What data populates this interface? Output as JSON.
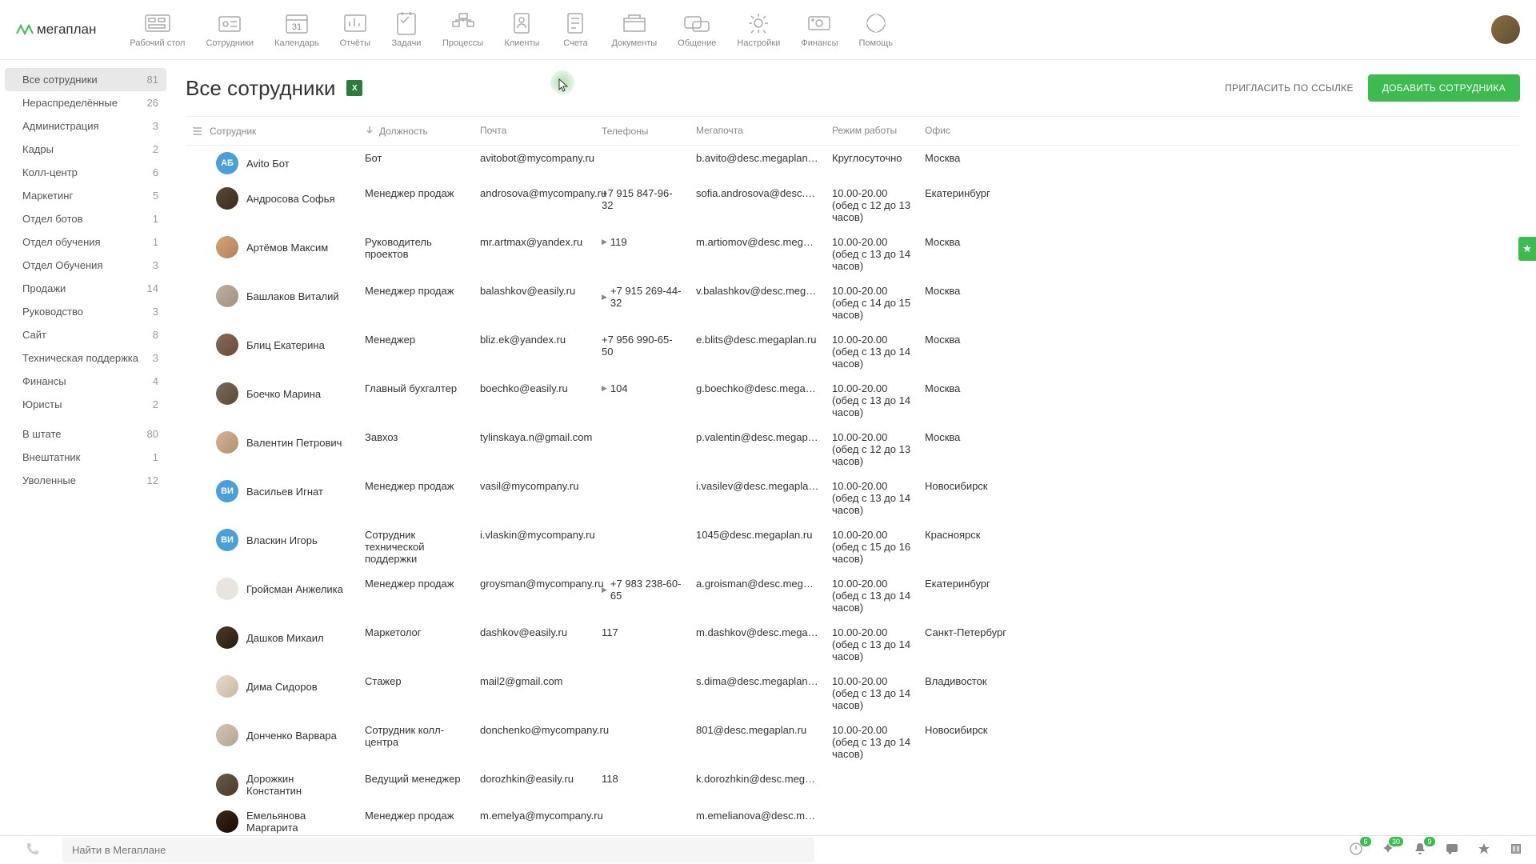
{
  "app": {
    "name": "мегаплан"
  },
  "nav": [
    {
      "label": "Рабочий стол"
    },
    {
      "label": "Сотрудники"
    },
    {
      "label": "Календарь"
    },
    {
      "label": "Отчёты"
    },
    {
      "label": "Задачи"
    },
    {
      "label": "Процессы"
    },
    {
      "label": "Клиенты"
    },
    {
      "label": "Счета"
    },
    {
      "label": "Документы"
    },
    {
      "label": "Общение"
    },
    {
      "label": "Настройки"
    },
    {
      "label": "Финансы"
    },
    {
      "label": "Помощь"
    }
  ],
  "sidebar": {
    "groups": [
      [
        {
          "label": "Все сотрудники",
          "count": "81",
          "active": true
        },
        {
          "label": "Нераспределённые",
          "count": "26"
        },
        {
          "label": "Администрация",
          "count": "3"
        },
        {
          "label": "Кадры",
          "count": "2"
        },
        {
          "label": "Колл-центр",
          "count": "6"
        },
        {
          "label": "Маркетинг",
          "count": "5"
        },
        {
          "label": "Отдел ботов",
          "count": "1"
        },
        {
          "label": "Отдел обучения",
          "count": "1"
        },
        {
          "label": "Отдел Обучения",
          "count": "3"
        },
        {
          "label": "Продажи",
          "count": "14"
        },
        {
          "label": "Руководство",
          "count": "3"
        },
        {
          "label": "Сайт",
          "count": "8"
        },
        {
          "label": "Техническая поддержка",
          "count": "3"
        },
        {
          "label": "Финансы",
          "count": "4"
        },
        {
          "label": "Юристы",
          "count": "2"
        }
      ],
      [
        {
          "label": "В штате",
          "count": "80"
        },
        {
          "label": "Внештатник",
          "count": "1"
        },
        {
          "label": "Уволенные",
          "count": "12"
        }
      ]
    ]
  },
  "page": {
    "title": "Все сотрудники",
    "invite_label": "ПРИГЛАСИТЬ ПО ССЫЛКЕ",
    "add_label": "ДОБАВИТЬ СОТРУДНИКА"
  },
  "table": {
    "headers": {
      "name": "Сотрудник",
      "position": "Должность",
      "email": "Почта",
      "phone": "Телефоны",
      "mega": "Мегапочта",
      "schedule": "Режим работы",
      "office": "Офис"
    },
    "rows": [
      {
        "initials": "АБ",
        "avatar_class": "blue",
        "name": "Avito Бот",
        "position": "Бот",
        "email": "avitobot@mycompany.ru",
        "phone": "",
        "mega": "b.avito@desc.megaplan.ru",
        "schedule": "Круглосуточно",
        "office": "Москва"
      },
      {
        "initials": "",
        "avatar_class": "img1",
        "name": "Андросова Софья",
        "position": "Менеджер продаж",
        "email": "androsova@mycompany.ru",
        "phone": "+7 915 847-96-32",
        "mega": "sofia.androsova@desc.megapl...",
        "schedule": "10.00-20.00 (обед с 12 до 13 часов)",
        "office": "Екатеринбург"
      },
      {
        "initials": "",
        "avatar_class": "img2",
        "name": "Артёмов Максим",
        "position": "Руководитель проектов",
        "email": "mr.artmax@yandex.ru",
        "phone": "119",
        "phone_expand": true,
        "mega": "m.artiomov@desc.megaplan.ru",
        "schedule": "10.00-20.00 (обед с 13 до 14 часов)",
        "office": "Москва"
      },
      {
        "initials": "",
        "avatar_class": "img3",
        "name": "Башлаков Виталий",
        "position": "Менеджер продаж",
        "email": "balashkov@easily.ru",
        "phone": "+7 915 269-44-32",
        "phone_expand": true,
        "mega": "v.balashkov@desc.megaplan.ru",
        "schedule": "10.00-20.00 (обед с 14 до 15 часов)",
        "office": "Москва"
      },
      {
        "initials": "",
        "avatar_class": "img4",
        "name": "Блиц Екатерина",
        "position": "Менеджер",
        "email": "bliz.ek@yandex.ru",
        "phone": "+7 956 990-65-50",
        "mega": "e.blits@desc.megaplan.ru",
        "schedule": "10.00-20.00 (обед с 13 до 14 часов)",
        "office": "Москва"
      },
      {
        "initials": "",
        "avatar_class": "img5",
        "name": "Боечко Марина",
        "position": "Главный бухгалтер",
        "email": "boechko@easily.ru",
        "phone": "104",
        "phone_expand": true,
        "mega": "g.boechko@desc.megaplan.ru",
        "schedule": "10.00-20.00 (обед с 13 до 14 часов)",
        "office": "Москва"
      },
      {
        "initials": "",
        "avatar_class": "img6",
        "name": "Валентин Петрович",
        "position": "Завхоз",
        "email": "tylinskaya.n@gmail.com",
        "phone": "",
        "mega": "p.valentin@desc.megaplan.ru",
        "schedule": "10.00-20.00 (обед с 12 до 13 часов)",
        "office": "Москва"
      },
      {
        "initials": "ВИ",
        "avatar_class": "blue",
        "name": "Васильев Игнат",
        "position": "Менеджер продаж",
        "email": "vasil@mycompany.ru",
        "phone": "",
        "mega": "i.vasilev@desc.megaplan.ru",
        "schedule": "10.00-20.00 (обед с 13 до 14 часов)",
        "office": "Новосибирск"
      },
      {
        "initials": "ВИ",
        "avatar_class": "blue",
        "name": "Власкин Игорь",
        "position": "Сотрудник технической поддержки",
        "email": "i.vlaskin@mycompany.ru",
        "phone": "",
        "mega": "1045@desc.megaplan.ru",
        "schedule": "10.00-20.00 (обед с 15 до 16 часов)",
        "office": "Красноярск"
      },
      {
        "initials": "",
        "avatar_class": "img7",
        "name": "Гройсман Анжелика",
        "position": "Менеджер продаж",
        "email": "groysman@mycompany.ru",
        "phone": "+7 983 238-60-65",
        "phone_expand": true,
        "mega": "a.groisman@desc.megaplan.ru",
        "schedule": "10.00-20.00 (обед с 13 до 14 часов)",
        "office": "Екатеринбург"
      },
      {
        "initials": "",
        "avatar_class": "img8",
        "name": "Дашков Михаил",
        "position": "Маркетолог",
        "email": "dashkov@easily.ru",
        "phone": "117",
        "mega": "m.dashkov@desc.megaplan.ru",
        "schedule": "10.00-20.00 (обед с 13 до 14 часов)",
        "office": "Санкт-Петербург"
      },
      {
        "initials": "",
        "avatar_class": "img9",
        "name": "Дима Сидоров",
        "position": "Стажер",
        "email": "mail2@gmail.com",
        "phone": "",
        "mega": "s.dima@desc.megaplan.ru",
        "schedule": "10.00-20.00 (обед с 13 до 14 часов)",
        "office": "Владивосток"
      },
      {
        "initials": "",
        "avatar_class": "img10",
        "name": "Донченко Варвара",
        "position": "Сотрудник колл-центра",
        "email": "donchenko@mycompany.ru",
        "phone": "",
        "mega": "801@desc.megaplan.ru",
        "schedule": "10.00-20.00 (обед с 13 до 14 часов)",
        "office": "Новосибирск"
      },
      {
        "initials": "",
        "avatar_class": "img11",
        "name": "Дорожкин Константин",
        "position": "Ведущий менеджер",
        "email": "dorozhkin@easily.ru",
        "phone": "118",
        "mega": "k.dorozhkin@desc.megaplan.ru",
        "schedule": "",
        "office": ""
      },
      {
        "initials": "",
        "avatar_class": "img12",
        "name": "Емельянова Маргарита",
        "position": "Менеджер продаж",
        "email": "m.emelya@mycompany.ru",
        "phone": "",
        "mega": "m.emelianova@desc.megaplan...",
        "schedule": "",
        "office": ""
      }
    ]
  },
  "search": {
    "placeholder": "Найти в Мегаплане"
  },
  "badges": {
    "b1": "6",
    "b2": "30",
    "b3": "9"
  }
}
